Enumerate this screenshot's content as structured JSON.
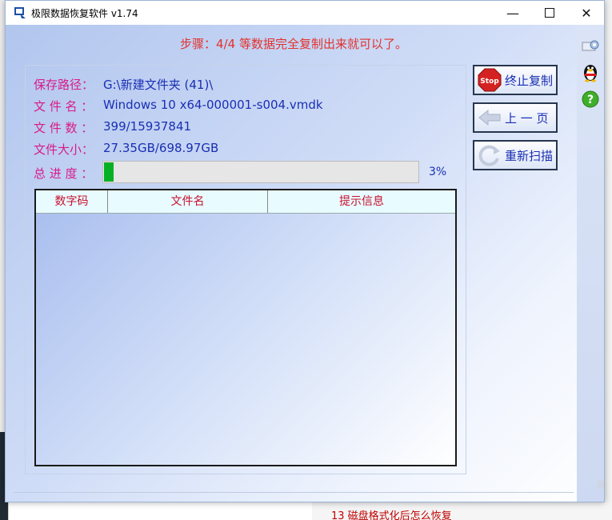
{
  "window": {
    "title": "极限数据恢复软件 v1.74",
    "minimize_glyph": "—",
    "close_glyph": "✕"
  },
  "step_text": "步骤：4/4 等数据完全复制出来就可以了。",
  "info": {
    "save_path_label": "保存路径：",
    "save_path_value": "G:\\新建文件夹 (41)\\",
    "file_name_label": "文 件 名 ：",
    "file_name_value": "Windows 10 x64-000001-s004.vmdk",
    "file_count_label": "文 件 数 ：",
    "file_count_value": "399/15937841",
    "file_size_label": "文件大小：",
    "file_size_value": "27.35GB/698.97GB",
    "progress_label": "总 进 度 ：",
    "progress_percent": 3,
    "progress_text": "3%"
  },
  "table": {
    "columns": [
      "数字码",
      "文件名",
      "提示信息"
    ],
    "rows": []
  },
  "buttons": {
    "stop_label": "终止复制",
    "stop_icon_text": "Stop",
    "prev_label": "上 一 页",
    "rescan_label": "重新扫描"
  },
  "background": {
    "bottom_text": "13    磁盘格式化后怎么恢复"
  },
  "colors": {
    "progress_fill": "#06b025",
    "label_color": "#d81b8a",
    "value_color": "#1a2fb3",
    "step_color": "#e2322d"
  }
}
